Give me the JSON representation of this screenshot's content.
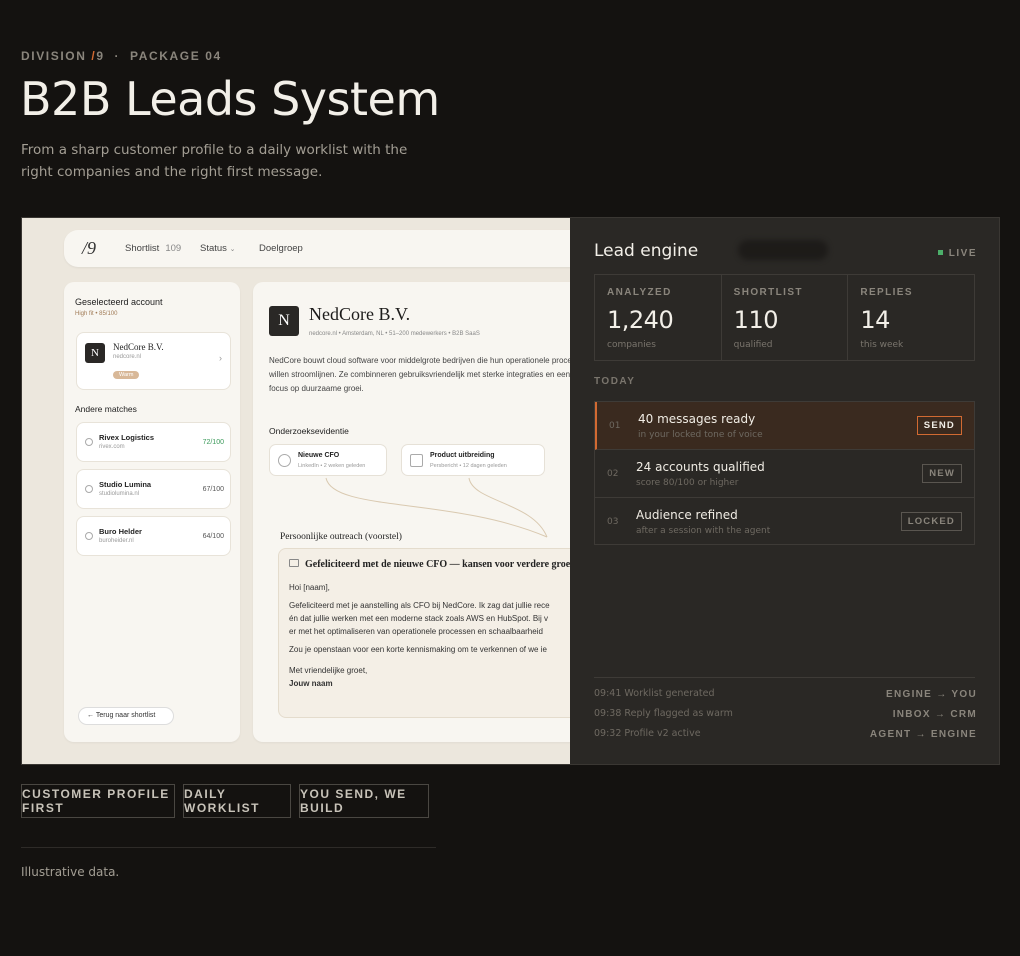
{
  "header": {
    "division": "DIVISION",
    "division_num": "9",
    "package": "PACKAGE 04",
    "title": "B2B Leads System",
    "subtitle": "From a sharp customer profile to a daily worklist with the right companies and the right first message."
  },
  "app": {
    "logo": "/9",
    "nav": [
      {
        "label": "Shortlist",
        "count": "109"
      },
      {
        "label": "Status"
      },
      {
        "label": "Doelgroep"
      }
    ],
    "selected_title": "Geselecteerd account",
    "selected_fit": "High fit • 85/100",
    "selected_account": {
      "initial": "N",
      "name": "NedCore B.V.",
      "domain": "nedcore.nl",
      "badge": "Warm"
    },
    "matches_title": "Andere matches",
    "matches": [
      {
        "name": "Rivex Logistics",
        "domain": "rivex.com",
        "score": "72/100"
      },
      {
        "name": "Studio Lumina",
        "domain": "studiolumina.nl",
        "score": "67/100"
      },
      {
        "name": "Buro Helder",
        "domain": "buroheider.nl",
        "score": "64/100"
      }
    ],
    "back_label": "Terug naar shortlist",
    "company": {
      "initial": "N",
      "name": "NedCore B.V.",
      "meta": "nedcore.nl  •  Amsterdam, NL  •  51–200 medewerkers  •  B2B SaaS",
      "description": "NedCore bouwt cloud software voor middelgrote bedrijven die hun operationele processen willen stroomlijnen. Ze combinneren gebruiksvriendelijk met sterke integraties en een focus op duurzaame groei."
    },
    "evidence_title": "Onderzoeksevidentie",
    "evidence": [
      {
        "title": "Nieuwe CFO",
        "sub": "LinkedIn • 2 weken geleden"
      },
      {
        "title": "Product uitbreiding",
        "sub": "Persbericht • 12 dagen geleden"
      }
    ],
    "outreach_title": "Persoonlijke outreach (voorstel)",
    "mail": {
      "subject": "Gefeliciteerd met de nieuwe CFO — kansen voor verdere groei",
      "greeting": "Hoi [naam],",
      "line1": "Gefeliciteerd met je aanstelling als CFO bij NedCore. Ik zag dat jullie rece",
      "line2": "én dat jullie werken met een moderne stack zoals AWS en HubSpot. Bij v",
      "line3": "er met het optimaliseren van operationele processen en schaalbaarheid",
      "line4": "Zou je openstaan voor een korte kennismaking om te verkennen of we ie",
      "closing": "Met vriendelijke groet,",
      "signature": "Jouw naam"
    }
  },
  "engine": {
    "title": "Lead engine",
    "live": "LIVE",
    "stats": [
      {
        "label": "ANALYZED",
        "value": "1,240",
        "unit": "companies"
      },
      {
        "label": "SHORTLIST",
        "value": "110",
        "unit": "qualified"
      },
      {
        "label": "REPLIES",
        "value": "14",
        "unit": "this week"
      }
    ],
    "today_label": "TODAY",
    "tasks": [
      {
        "num": "01",
        "title": "40 messages ready",
        "sub": "in your locked tone of voice",
        "tag": "SEND"
      },
      {
        "num": "02",
        "title": "24 accounts qualified",
        "sub": "score 80/100 or higher",
        "tag": "NEW"
      },
      {
        "num": "03",
        "title": "Audience refined",
        "sub": "after a session with the agent",
        "tag": "LOCKED"
      }
    ],
    "log": [
      {
        "time": "09:41",
        "text": "Worklist generated"
      },
      {
        "time": "09:38",
        "text": "Reply flagged as warm"
      },
      {
        "time": "09:32",
        "text": "Profile v2 active"
      }
    ],
    "routes": [
      "ENGINE → YOU",
      "INBOX → CRM",
      "AGENT → ENGINE"
    ]
  },
  "pills": [
    "CUSTOMER PROFILE FIRST",
    "DAILY WORKLIST",
    "YOU SEND, WE BUILD"
  ],
  "footnote": "Illustrative data.",
  "colors": {
    "accent": "#d26a32",
    "live": "#4caf6a",
    "bg": "#141210",
    "panel": "#2a2825"
  }
}
